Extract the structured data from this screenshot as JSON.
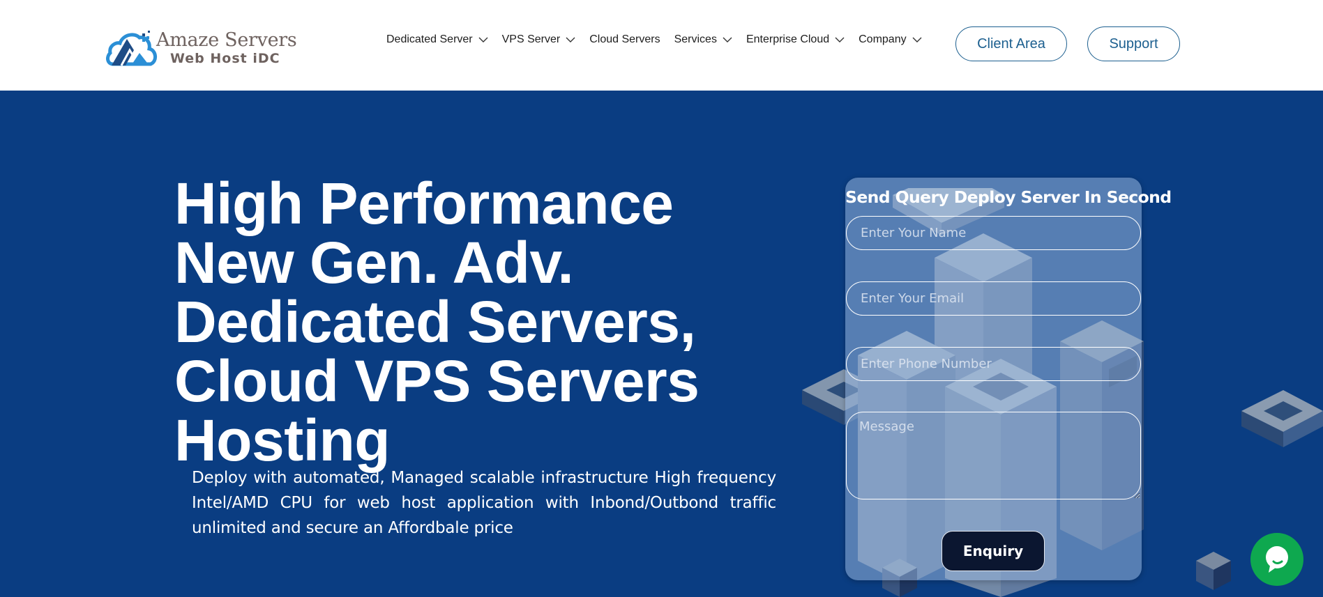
{
  "header": {
    "logo": {
      "title": "Amaze Servers",
      "subtitle": "Web Host iDC",
      "icon": "cloud-logo-icon"
    },
    "nav": [
      {
        "label": "Dedicated Server",
        "has_dropdown": true
      },
      {
        "label": "VPS Server",
        "has_dropdown": true
      },
      {
        "label": "Cloud Servers",
        "has_dropdown": false
      },
      {
        "label": "Services",
        "has_dropdown": true
      },
      {
        "label": "Enterprise Cloud",
        "has_dropdown": true
      },
      {
        "label": "Company",
        "has_dropdown": true
      }
    ],
    "client_area_label": "Client Area",
    "support_label": "Support"
  },
  "hero": {
    "title": "High Performance New Gen. Adv. Dedicated Servers, Cloud VPS Servers Hosting",
    "description": "Deploy with automated, Managed scalable infrastructure High frequency Intel/AMD CPU for web host application with Inbond/Outbond traffic unlimited and secure an Affordbale price"
  },
  "form": {
    "title": "Send Query Deploy Server In Second",
    "name_placeholder": "Enter Your Name",
    "email_placeholder": "Enter Your Email",
    "phone_placeholder": "Enter Phone Number",
    "message_placeholder": "Message",
    "submit_label": "Enquiry"
  },
  "chat": {
    "icon": "chat-bubble-icon"
  },
  "colors": {
    "hero_bg": "#0a3d82",
    "accent": "#1c5f8f",
    "button_dark": "#0b1630",
    "chat_green": "#0ea84f"
  }
}
